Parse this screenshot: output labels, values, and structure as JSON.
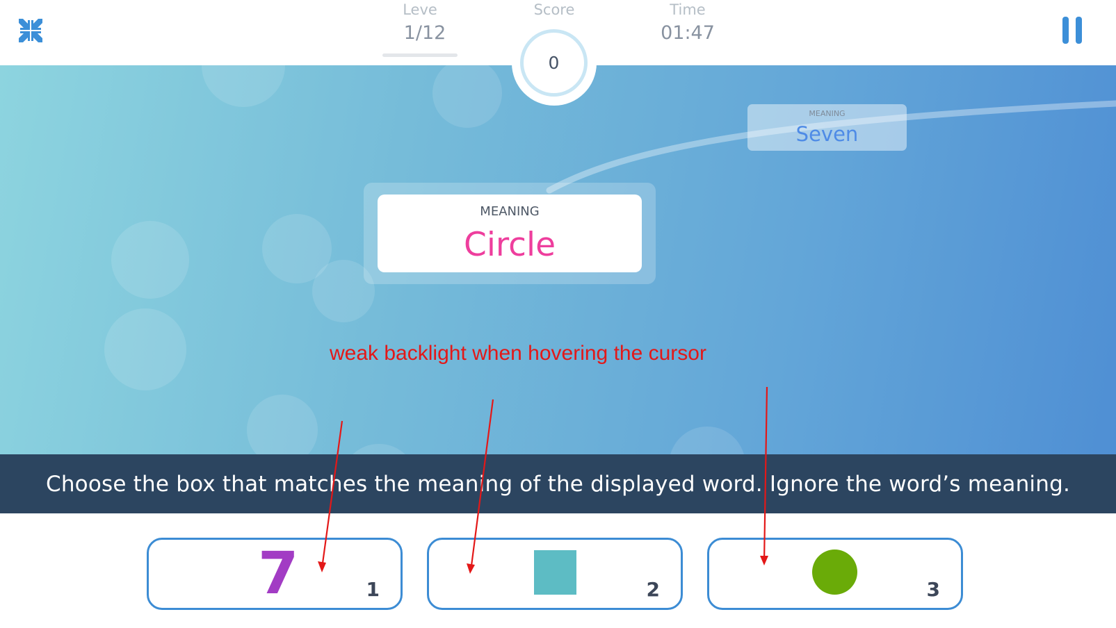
{
  "colors": {
    "accent": "#3c8cd4",
    "word": "#ee3e9d",
    "annotation": "#e31818",
    "seven": "#a23cc4",
    "square": "#5dbcc4",
    "circle": "#6aab08"
  },
  "header": {
    "level_label": "Leve",
    "level_value": "1/12",
    "score_label": "Score",
    "score_value": "0",
    "time_label": "Time",
    "time_value": "01:47",
    "collapse_icon": "collapse-icon",
    "pause_icon": "pause-icon"
  },
  "card": {
    "label": "MEANING",
    "word": "Circle"
  },
  "ghost_card": {
    "label": "MEANING",
    "word": "Seven"
  },
  "annotation": "weak backlight when hovering the cursor",
  "instruction": "Choose the box that matches the meaning of the displayed word. Ignore the word’s meaning.",
  "options": [
    {
      "content": "7",
      "key": "1"
    },
    {
      "content": "teal square",
      "key": "2"
    },
    {
      "content": "green circle",
      "key": "3"
    }
  ]
}
